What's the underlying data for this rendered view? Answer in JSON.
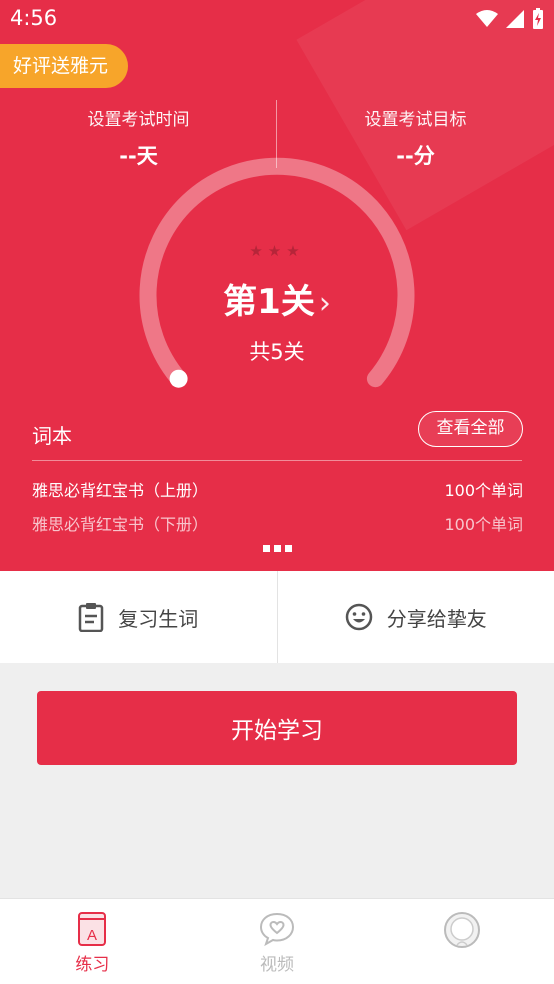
{
  "status_bar": {
    "time": "4:56"
  },
  "promo": {
    "label": "好评送雅元"
  },
  "exam": {
    "time_label": "设置考试时间",
    "time_value": "--天",
    "target_label": "设置考试目标",
    "target_value": "--分"
  },
  "level": {
    "stars": "★★★",
    "title": "第1关",
    "chevron": "›",
    "total": "共5关",
    "progress": 0
  },
  "wordbook": {
    "header": "词本",
    "view_all": "查看全部",
    "books": [
      {
        "name": "雅思必背红宝书（上册）",
        "count": "100个单词"
      },
      {
        "name": "雅思必背红宝书（下册）",
        "count": "100个单词"
      }
    ]
  },
  "actions": {
    "review": "复习生词",
    "share": "分享给挚友"
  },
  "start_button": "开始学习",
  "tabs": [
    {
      "label": "练习",
      "icon": "book-a-icon",
      "active": true
    },
    {
      "label": "视频",
      "icon": "heart-chat-icon",
      "active": false
    },
    {
      "label": "",
      "icon": "avatar-icon",
      "active": false
    }
  ],
  "colors": {
    "brand": "#e62e48",
    "promo": "#f7a52a"
  }
}
